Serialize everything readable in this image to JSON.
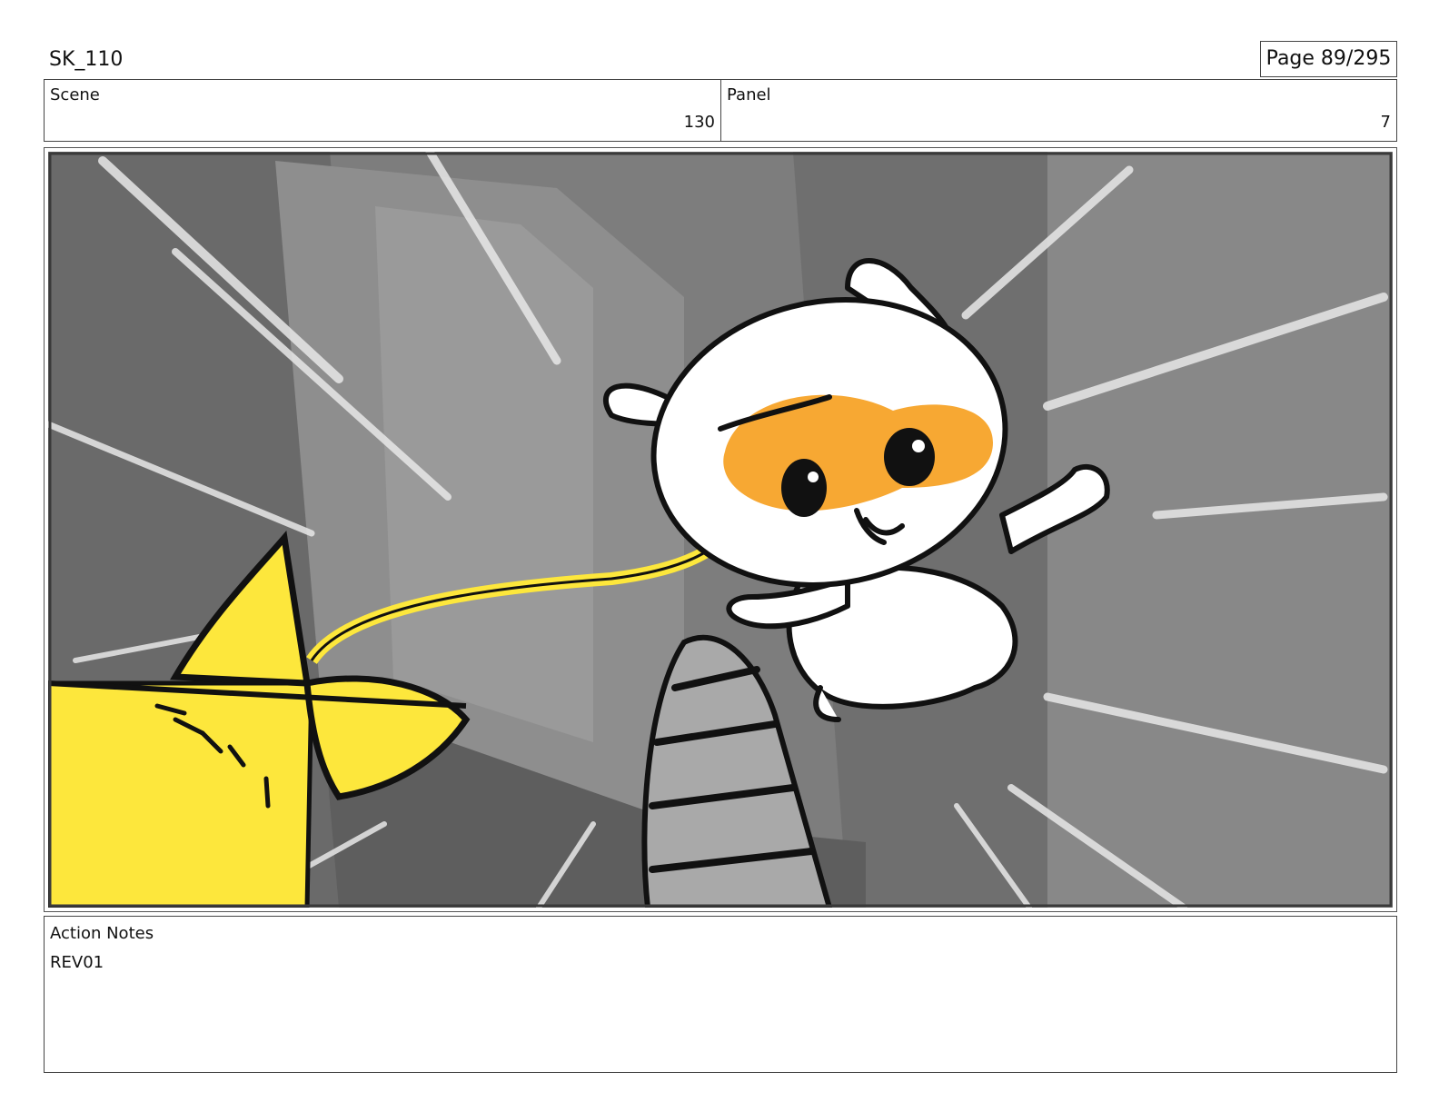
{
  "document": {
    "title": "SK_110",
    "page": "Page  89/295"
  },
  "header": {
    "scene_label": "Scene",
    "scene_value": "130",
    "panel_label": "Panel",
    "panel_value": "7"
  },
  "notes": {
    "label": "Action Notes",
    "text": "REV01"
  },
  "colors": {
    "sketch_yellow": "#fde73c",
    "mask_orange": "#f7a833",
    "background_gray": "#7a7a7a"
  }
}
